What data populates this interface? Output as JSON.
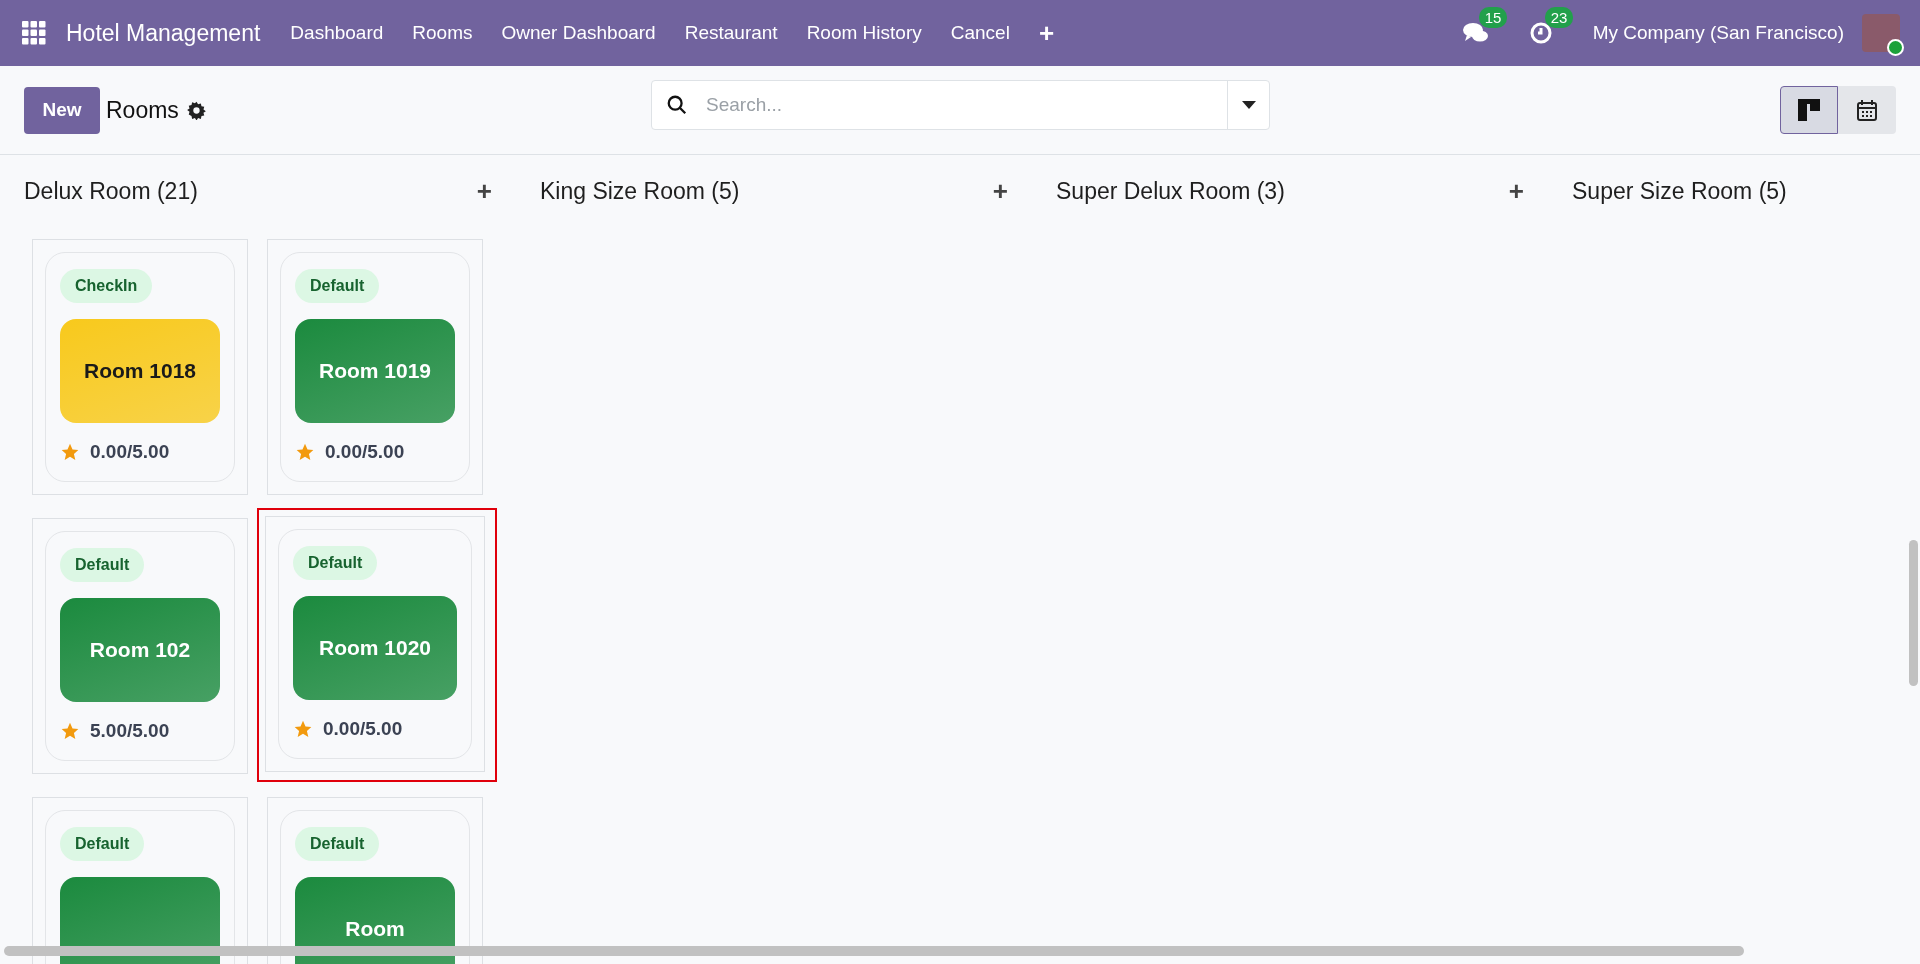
{
  "navbar": {
    "app_name": "Hotel Management",
    "menu": [
      "Dashboard",
      "Rooms",
      "Owner Dashboard",
      "Restaurant",
      "Room History",
      "Cancel"
    ],
    "add_symbol": "+",
    "messages_count": "15",
    "activities_count": "23",
    "company": "My Company (San Francisco)"
  },
  "control_panel": {
    "new_button": "New",
    "title": "Rooms",
    "search": {
      "placeholder": "Search..."
    },
    "views": [
      {
        "kind": "kanban",
        "selected": true
      },
      {
        "kind": "calendar",
        "selected": false
      }
    ]
  },
  "groups": [
    {
      "title": "Delux Room (21)",
      "add_symbol": "+",
      "cards": [
        {
          "status": "CheckIn",
          "name": "Room 1018",
          "rating": "0.00/5.00",
          "color": "#f8c91c",
          "selected": false
        },
        {
          "status": "Default",
          "name": "Room 1019",
          "rating": "0.00/5.00",
          "color": "#1b8a3e",
          "selected": false
        },
        {
          "status": "Default",
          "name": "Room 102",
          "rating": "5.00/5.00",
          "color": "#1b8a3e",
          "selected": false
        },
        {
          "status": "Default",
          "name": "Room 1020",
          "rating": "0.00/5.00",
          "color": "#1b8a3e",
          "selected": true
        },
        {
          "status": "Default",
          "color": "#1b8a3e",
          "selected": false
        },
        {
          "status": "Default",
          "name": "Room",
          "color": "#1b8a3e",
          "selected": false
        }
      ]
    },
    {
      "title": "King Size Room (5)",
      "add_symbol": "+"
    },
    {
      "title": "Super Delux Room (3)",
      "add_symbol": "+"
    },
    {
      "title": "Super Size Room (5)"
    }
  ]
}
